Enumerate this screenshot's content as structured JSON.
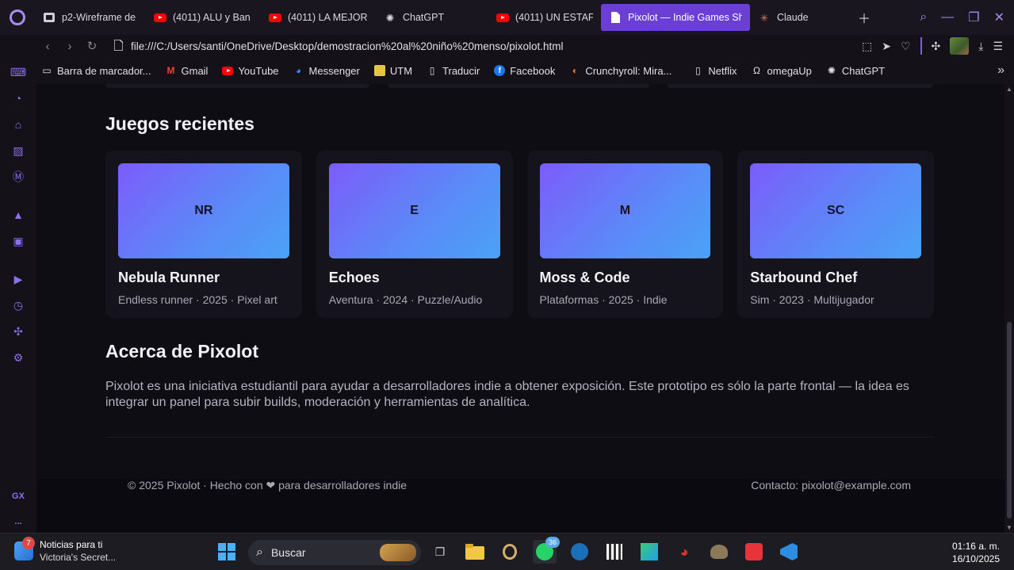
{
  "browser": {
    "tabs": [
      {
        "label": "p2-Wireframe de",
        "icon": "drive-icon",
        "active": false
      },
      {
        "label": "(4011) ALU y Ban",
        "icon": "youtube-icon",
        "active": false
      },
      {
        "label": "(4011) LA MEJOR",
        "icon": "youtube-icon",
        "active": false
      },
      {
        "label": "ChatGPT",
        "icon": "chatgpt-icon",
        "active": false
      },
      {
        "label": "(4011) UN ESTAF",
        "icon": "youtube-icon",
        "active": false
      },
      {
        "label": "Pixolot — Indie Games Sh",
        "icon": "file-icon",
        "active": true
      },
      {
        "label": "Claude",
        "icon": "claude-icon",
        "active": false
      }
    ],
    "url": "file:///C:/Users/santi/OneDrive/Desktop/demostracion%20al%20niño%20menso/pixolot.html",
    "bookmarks": [
      {
        "label": "Barra de marcador...",
        "icon": "folder-icon"
      },
      {
        "label": "Gmail",
        "icon": "gmail-icon"
      },
      {
        "label": "YouTube",
        "icon": "youtube-icon"
      },
      {
        "label": "Messenger",
        "icon": "messenger-icon"
      },
      {
        "label": "UTM",
        "icon": "utm-icon"
      },
      {
        "label": "Traducir",
        "icon": "page-icon"
      },
      {
        "label": "Facebook",
        "icon": "facebook-icon"
      },
      {
        "label": "Crunchyroll: Mira...",
        "icon": "crunchyroll-icon"
      },
      {
        "label": "Netflix",
        "icon": "page-icon"
      },
      {
        "label": "omegaUp",
        "icon": "omega-icon"
      },
      {
        "label": "ChatGPT",
        "icon": "chatgpt-icon"
      }
    ],
    "sidebar_gx_label": "GX",
    "sidebar_more": "..."
  },
  "page": {
    "recent_title": "Juegos recientes",
    "games": [
      {
        "initials": "NR",
        "title": "Nebula Runner",
        "meta": "Endless runner · 2025 · Pixel art"
      },
      {
        "initials": "E",
        "title": "Echoes",
        "meta": "Aventura · 2024 · Puzzle/Audio"
      },
      {
        "initials": "M",
        "title": "Moss & Code",
        "meta": "Plataformas · 2025 · Indie"
      },
      {
        "initials": "SC",
        "title": "Starbound Chef",
        "meta": "Sim · 2023 · Multijugador"
      }
    ],
    "about_title": "Acerca de Pixolot",
    "about_text": "Pixolot es una iniciativa estudiantil para ayudar a desarrolladores indie a obtener exposición. Este prototipo es sólo la parte frontal — la idea es integrar un panel para subir builds, moderación y herramientas de analítica.",
    "footer_left": "© 2025 Pixolot · Hecho con ❤ para desarrolladores indie",
    "footer_right": "Contacto: pixolot@example.com",
    "accent_gradient": [
      "#7c5cfa",
      "#4aa2f6"
    ]
  },
  "taskbar": {
    "news_badge": "7",
    "news_title": "Noticias para ti",
    "news_sub": "Victoria's Secret...",
    "search_label": "Buscar",
    "whatsapp_badge": "36",
    "time": "01:16 a. m.",
    "date": "16/10/2025"
  }
}
